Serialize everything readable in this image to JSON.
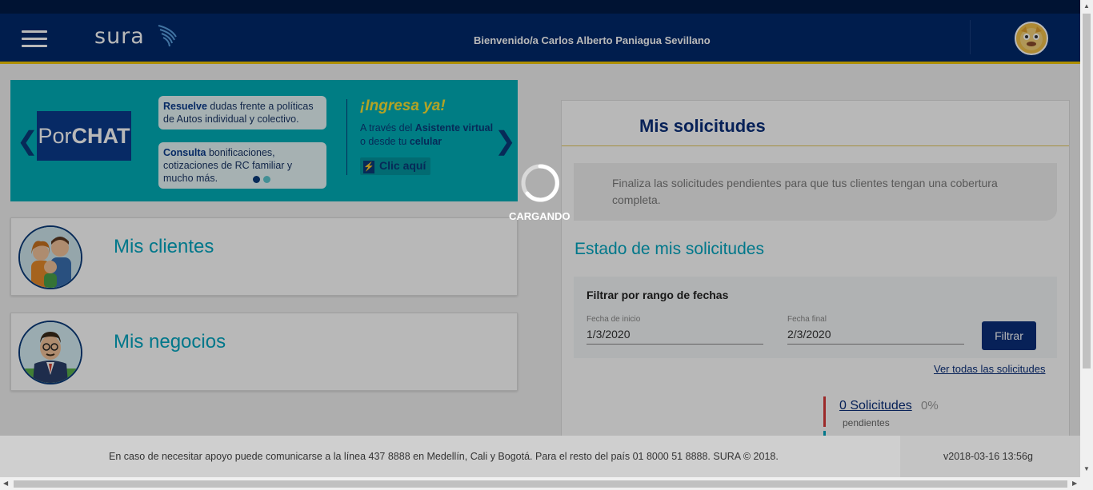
{
  "header": {
    "logo_text": "sura",
    "welcome": "Bienvenido/a Carlos Alberto Paniagua Sevillano",
    "menu_icon": "hamburger-icon",
    "avatar_icon": "user-avatar"
  },
  "banner": {
    "brand_light": "Por",
    "brand_bold": "CHAT",
    "bubble1_bold": "Resuelve",
    "bubble1_rest": " dudas frente a políticas de Autos individual y colectivo.",
    "bubble2_bold": "Consulta",
    "bubble2_rest": " bonificaciones, cotizaciones de RC familiar y mucho más.",
    "headline": "¡Ingresa ya!",
    "line1_pre": "A través del ",
    "line1_bold": "Asistente virtual",
    "line2_pre": "o desde tu ",
    "line2_bold": "celular",
    "cta": "Clic aquí",
    "prev_icon": "chevron-left-icon",
    "next_icon": "chevron-right-icon",
    "dots_active": 0,
    "dots_total": 2
  },
  "cards": {
    "clientes": "Mis clientes",
    "negocios": "Mis negocios"
  },
  "solicitudes": {
    "title": "Mis solicitudes",
    "note": "Finaliza las solicitudes pendientes para que tus clientes tengan una cobertura completa.",
    "estado_title": "Estado de mis solicitudes",
    "filter_title": "Filtrar por rango de fechas",
    "start_label": "Fecha de inicio",
    "start_value": "1/3/2020",
    "end_label": "Fecha final",
    "end_value": "2/3/2020",
    "filter_button": "Filtrar",
    "ver_todas": "Ver todas las solicitudes",
    "pending_count": "0 Solicitudes",
    "pending_pct": "0%",
    "pending_label": "pendientes"
  },
  "loading": {
    "text": "CARGANDO"
  },
  "footer": {
    "text": "En caso de necesitar apoyo puede comunicarse a la línea 437 8888 en Medellín, Cali y Bogotá. Para el resto del país 01 8000 51 8888. SURA © 2018.",
    "version": "v2018-03-16 13:56g"
  },
  "colors": {
    "header": "#00296b",
    "accent_yellow": "#f2c700",
    "teal": "#00a6c0",
    "banner_bg": "#00aeb8",
    "primary_button": "#0a2f7a"
  }
}
